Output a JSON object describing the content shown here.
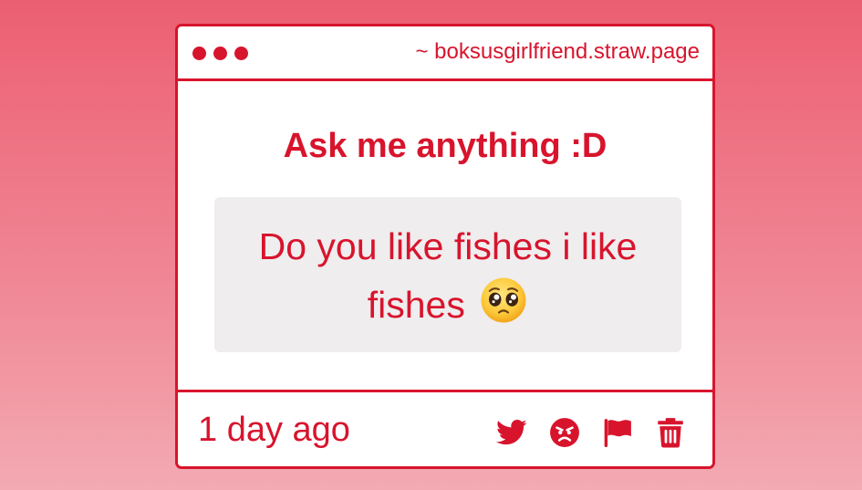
{
  "window": {
    "url": "~ boksusgirlfriend.straw.page"
  },
  "card": {
    "title": "Ask me anything :D",
    "question": "Do you like fishes i like fishes",
    "question_emoji": "pleading-face-emoji",
    "timestamp": "1 day ago"
  },
  "actions": [
    {
      "icon": "twitter-icon"
    },
    {
      "icon": "angry-face-icon"
    },
    {
      "icon": "flag-icon"
    },
    {
      "icon": "trash-icon"
    }
  ],
  "colors": {
    "accent": "#d8142d",
    "box_background": "#efedee",
    "page_gradient_top": "#ec5f72",
    "page_gradient_bottom": "#f3aab3"
  }
}
